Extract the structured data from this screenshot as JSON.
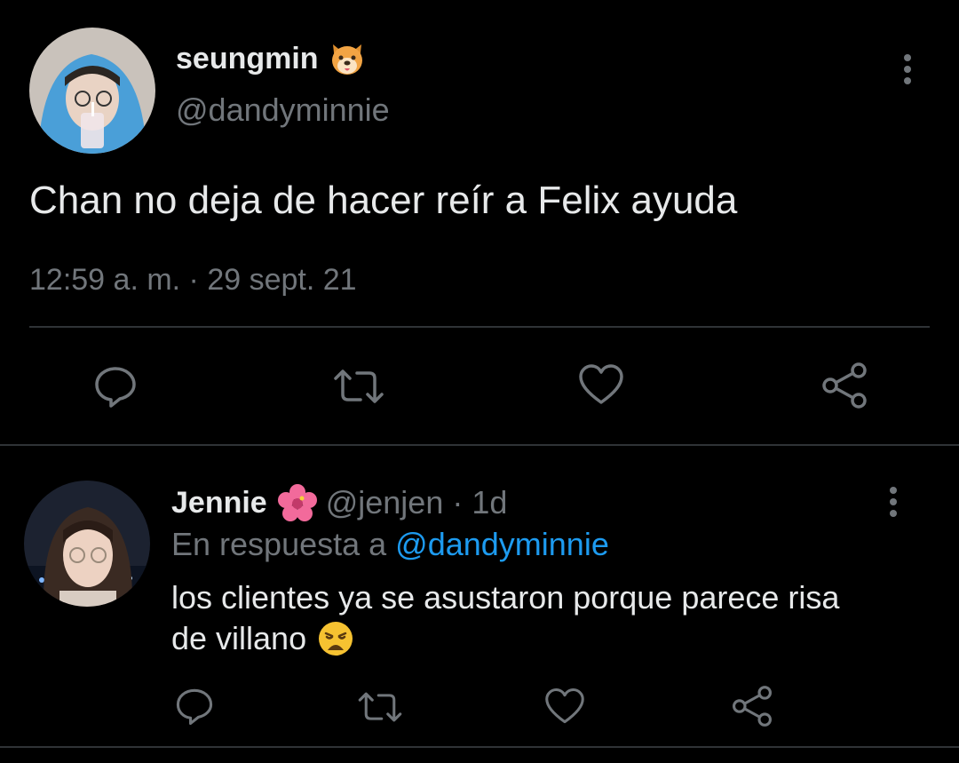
{
  "tweet": {
    "author_name": "seungmin",
    "author_emoji": "dog-face-emoji",
    "handle": "@dandyminnie",
    "text": "Chan no deja de hacer reír a Felix ayuda",
    "timestamp": "12:59 a. m. · 29 sept. 21",
    "actions": [
      "reply-icon",
      "retweet-icon",
      "like-icon",
      "share-icon"
    ]
  },
  "reply": {
    "author_name": "Jennie",
    "author_emoji": "hibiscus-emoji",
    "handle": "@jenjen",
    "age": "· 1d",
    "replying_prefix": "En respuesta a",
    "replying_to": "@dandyminnie",
    "text_line1": "los clientes ya se asustaron porque parece risa",
    "text_line2": "de villano",
    "text_emoji": "weary-face-emoji",
    "actions": [
      "reply-icon",
      "retweet-icon",
      "like-icon",
      "share-icon"
    ]
  },
  "colors": {
    "background": "#000000",
    "primary_text": "#e7e9ea",
    "secondary_text": "#71767b",
    "link": "#1d9bf0",
    "divider": "#2f3336"
  }
}
